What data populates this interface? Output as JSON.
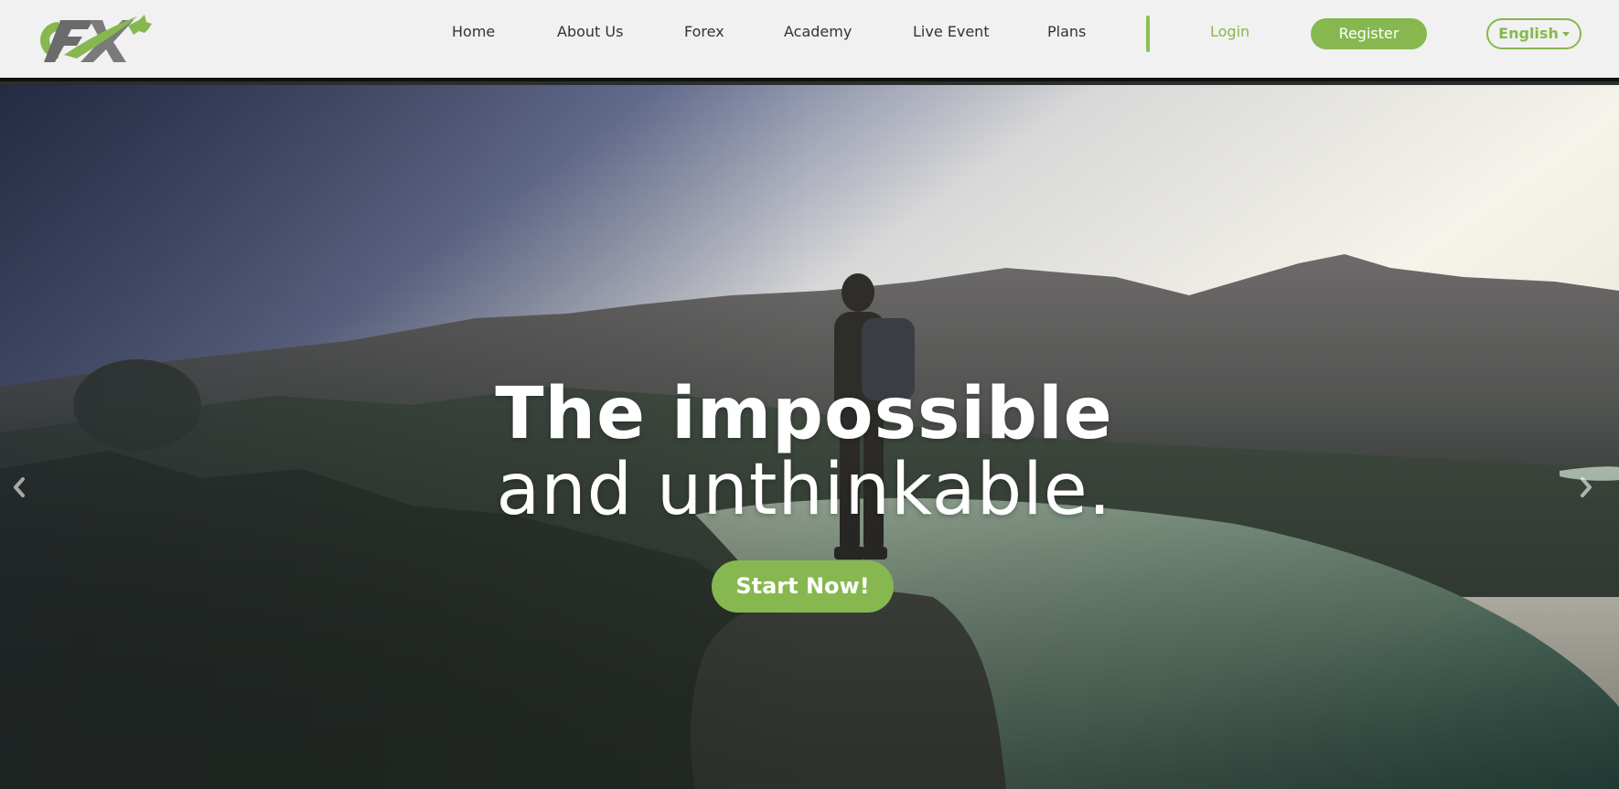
{
  "brand": {
    "logo_icon": "cfx-bull-logo-icon",
    "accent_color": "#86b84f",
    "header_bg": "#f1f1f1"
  },
  "nav": {
    "items": [
      {
        "label": "Home"
      },
      {
        "label": "About Us"
      },
      {
        "label": "Forex"
      },
      {
        "label": "Academy"
      },
      {
        "label": "Live Event"
      },
      {
        "label": "Plans"
      }
    ],
    "login_label": "Login",
    "register_label": "Register",
    "language_label": "English"
  },
  "hero": {
    "title": "The impossible",
    "subtitle": "and unthinkable.",
    "cta_label": "Start Now!",
    "prev_icon": "chevron-left-icon",
    "next_icon": "chevron-right-icon"
  }
}
